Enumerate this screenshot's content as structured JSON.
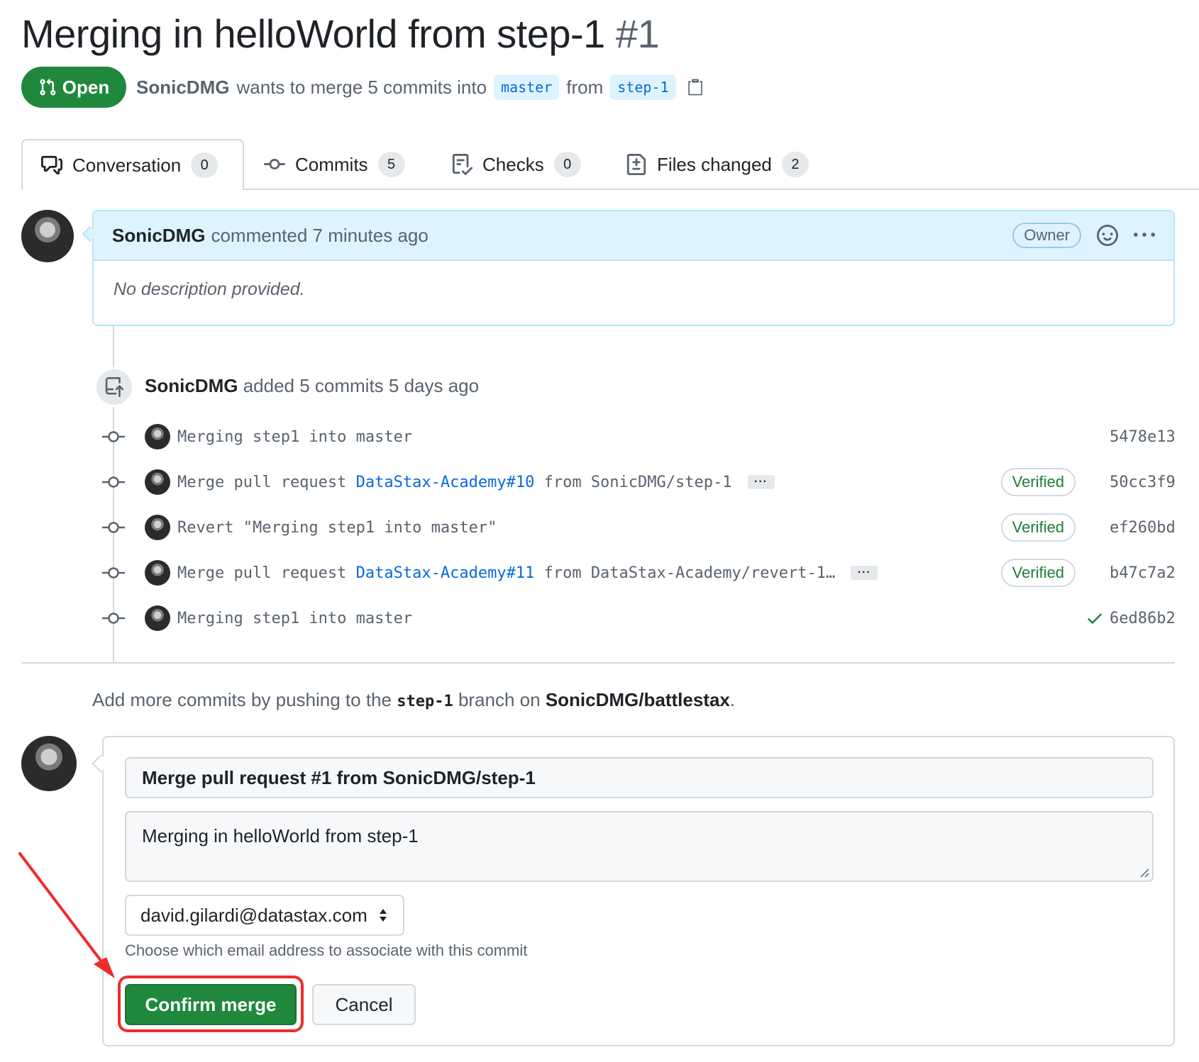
{
  "header": {
    "title": "Merging in helloWorld from step-1",
    "number": "#1"
  },
  "state": {
    "label": "Open",
    "author": "SonicDMG",
    "text": "wants to merge 5 commits into",
    "base_branch": "master",
    "from_text": "from",
    "head_branch": "step-1"
  },
  "tabs": [
    {
      "label": "Conversation",
      "count": "0"
    },
    {
      "label": "Commits",
      "count": "5"
    },
    {
      "label": "Checks",
      "count": "0"
    },
    {
      "label": "Files changed",
      "count": "2"
    }
  ],
  "comment": {
    "author": "SonicDMG",
    "action": "commented 7 minutes ago",
    "role": "Owner",
    "body": "No description provided."
  },
  "push_event": {
    "author": "SonicDMG",
    "text": "added 5 commits 5 days ago"
  },
  "commits": [
    {
      "msg_pre": "Merging step1 into master",
      "link": "",
      "msg_post": "",
      "verified": "",
      "sha": "5478e13"
    },
    {
      "msg_pre": "Merge pull request ",
      "link": "DataStax-Academy#10",
      "msg_post": " from SonicDMG/step-1",
      "verified": "Verified",
      "sha": "50cc3f9"
    },
    {
      "msg_pre": "Revert \"Merging step1 into master\"",
      "link": "",
      "msg_post": "",
      "verified": "Verified",
      "sha": "ef260bd"
    },
    {
      "msg_pre": "Merge pull request ",
      "link": "DataStax-Academy#11",
      "msg_post": " from DataStax-Academy/revert-1…",
      "verified": "Verified",
      "sha": "b47c7a2"
    },
    {
      "msg_pre": "Merging step1 into master",
      "link": "",
      "msg_post": "",
      "verified": "",
      "sha": "6ed86b2"
    }
  ],
  "ellipsis_label": "···",
  "hint": {
    "pre": "Add more commits by pushing to the",
    "branch": "step-1",
    "mid": "branch on",
    "repo": "SonicDMG/battlestax",
    "post": "."
  },
  "merge_form": {
    "title_value": "Merge pull request #1 from SonicDMG/step-1",
    "body_value": "Merging in helloWorld from step-1",
    "email": "david.gilardi@datastax.com",
    "email_note": "Choose which email address to associate with this commit",
    "confirm_label": "Confirm merge",
    "cancel_label": "Cancel"
  },
  "colors": {
    "accent_green": "#1f883d",
    "link_blue": "#0969da",
    "annotation_red": "#ef2b2b"
  }
}
